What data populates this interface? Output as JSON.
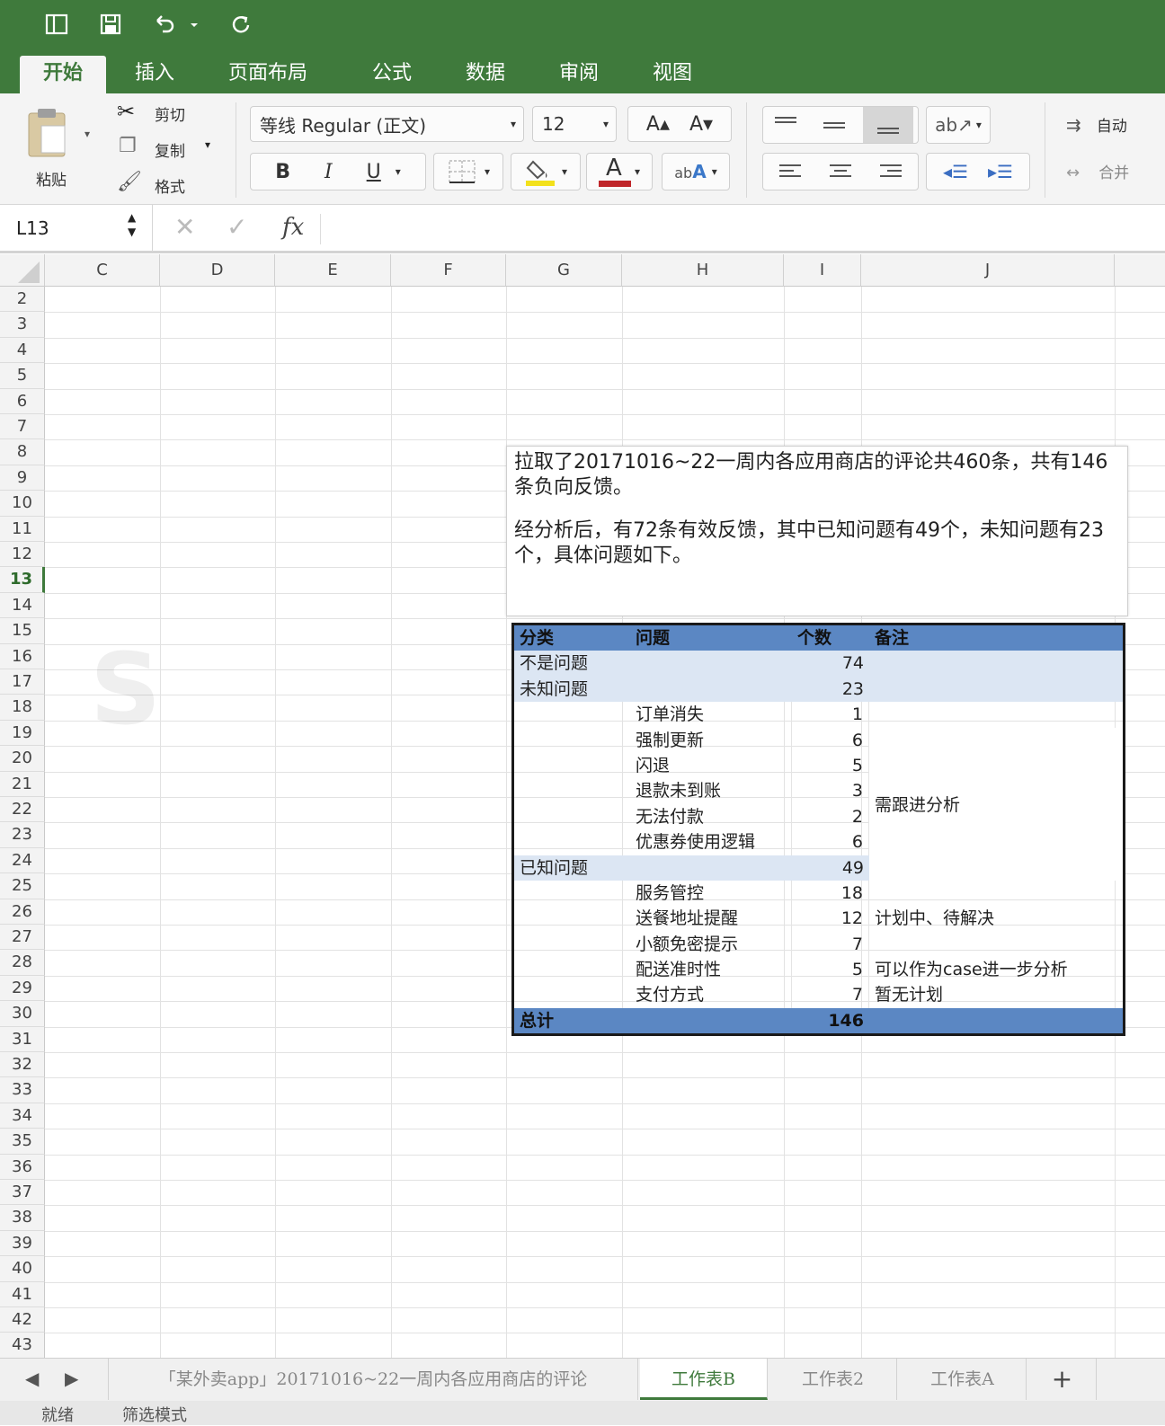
{
  "titlebar": {
    "quick_access": [
      "sidebar-icon",
      "save-icon",
      "undo-icon",
      "redo-icon"
    ]
  },
  "tabs": [
    "开始",
    "插入",
    "页面布局",
    "公式",
    "数据",
    "审阅",
    "视图"
  ],
  "ribbon": {
    "paste_label": "粘贴",
    "cut_label": "剪切",
    "copy_label": "复制",
    "format_label": "格式",
    "font_name": "等线 Regular (正文)",
    "font_size": "12",
    "bold": "B",
    "italic": "I",
    "underline": "U",
    "font_color_letter": "A",
    "wrap_label": "自动",
    "merge_label": "合并",
    "fill_color": "#f3e11c",
    "font_color": "#c0262a"
  },
  "formula_bar": {
    "cell_ref": "L13",
    "fx": "fx",
    "value": ""
  },
  "grid": {
    "columns": [
      "C",
      "D",
      "E",
      "F",
      "G",
      "H",
      "I",
      "J"
    ],
    "rows": [
      "2",
      "3",
      "4",
      "5",
      "6",
      "7",
      "8",
      "9",
      "10",
      "11",
      "12",
      "13",
      "14",
      "15",
      "16",
      "17",
      "18",
      "19",
      "20",
      "21",
      "22",
      "23",
      "24",
      "25",
      "26",
      "27",
      "28",
      "29",
      "30",
      "31",
      "32",
      "33",
      "34",
      "35",
      "36",
      "37",
      "38",
      "39",
      "40",
      "41",
      "42",
      "43"
    ],
    "selected_row": "13"
  },
  "textbox": {
    "para1": "拉取了20171016~22一周内各应用商店的评论共460条，共有146条负向反馈。",
    "para2": "经分析后，有72条有效反馈，其中已知问题有49个，未知问题有23个，具体问题如下。"
  },
  "table": {
    "headers": [
      "分类",
      "问题",
      "个数",
      "备注"
    ],
    "rows": [
      {
        "cat": "不是问题",
        "issue": "",
        "count": "74",
        "note": "",
        "style": "band"
      },
      {
        "cat": "未知问题",
        "issue": "",
        "count": "23",
        "note": "",
        "style": "band"
      },
      {
        "cat": "",
        "issue": "订单消失",
        "count": "1",
        "note": "",
        "style": "plain"
      },
      {
        "cat": "",
        "issue": "强制更新",
        "count": "6",
        "note": "",
        "style": "plain"
      },
      {
        "cat": "",
        "issue": "闪退",
        "count": "5",
        "note": "",
        "style": "plain"
      },
      {
        "cat": "",
        "issue": "退款未到账",
        "count": "3",
        "note": "",
        "style": "plain"
      },
      {
        "cat": "",
        "issue": "无法付款",
        "count": "2",
        "note": "",
        "style": "plain"
      },
      {
        "cat": "",
        "issue": "优惠券使用逻辑",
        "count": "6",
        "note": "",
        "style": "plain"
      },
      {
        "cat": "已知问题",
        "issue": "",
        "count": "49",
        "note": "",
        "style": "band"
      },
      {
        "cat": "",
        "issue": "服务管控",
        "count": "18",
        "note": "",
        "style": "plain"
      },
      {
        "cat": "",
        "issue": "送餐地址提醒",
        "count": "12",
        "note": "计划中、待解决",
        "style": "plain"
      },
      {
        "cat": "",
        "issue": "小额免密提示",
        "count": "7",
        "note": "",
        "style": "plain"
      },
      {
        "cat": "",
        "issue": "配送准时性",
        "count": "5",
        "note": "可以作为case进一步分析",
        "style": "plain"
      },
      {
        "cat": "",
        "issue": "支付方式",
        "count": "7",
        "note": "暂无计划",
        "style": "plain"
      }
    ],
    "merged_note": "需跟进分析",
    "total_label": "总计",
    "total_count": "146"
  },
  "sheet_tabs": {
    "tabs": [
      "「某外卖app」20171016~22一周内各应用商店的评论",
      "工作表B",
      "工作表2",
      "工作表A"
    ],
    "active": "工作表B",
    "add": "+"
  },
  "status": {
    "ready": "就绪",
    "mode": "筛选模式"
  }
}
